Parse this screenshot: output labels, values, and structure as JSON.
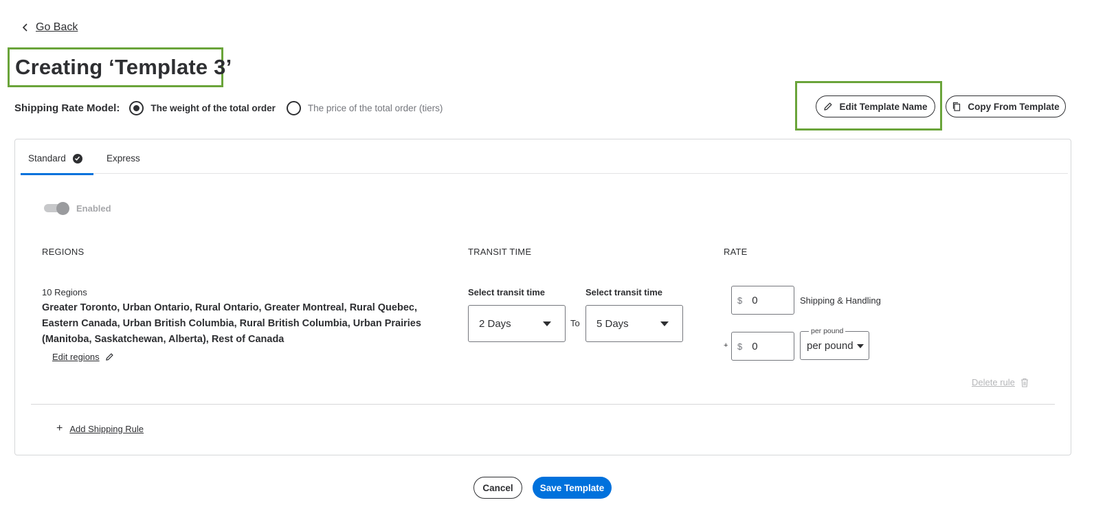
{
  "nav": {
    "go_back_label": "Go Back"
  },
  "header": {
    "title": "Creating ‘Template 3’",
    "shipping_rate_model_label": "Shipping Rate Model:",
    "rate_model_options": [
      {
        "label": "The weight of the total order",
        "selected": true
      },
      {
        "label": "The price of the total order (tiers)",
        "selected": false
      }
    ],
    "edit_template_name_label": "Edit Template Name",
    "copy_from_template_label": "Copy From Template"
  },
  "tabs": [
    {
      "label": "Standard",
      "active": true,
      "completed": true
    },
    {
      "label": "Express",
      "active": false
    }
  ],
  "toggle": {
    "label": "Enabled",
    "on": true,
    "disabled": true
  },
  "columns": {
    "regions": "REGIONS",
    "transit_time": "TRANSIT TIME",
    "rate": "RATE"
  },
  "rule": {
    "regions_count": "10 Regions",
    "regions_list": "Greater Toronto, Urban Ontario, Rural Ontario, Greater Montreal, Rural Quebec, Eastern Canada, Urban British Columbia, Rural British Columbia, Urban Prairies (Manitoba, Saskatchewan, Alberta), Rest of Canada",
    "edit_regions_label": "Edit regions",
    "transit_from_label": "Select transit time",
    "transit_from_value": "2 Days",
    "transit_to_label": "Select transit time",
    "transit_to_value": "5 Days",
    "to_label": "To",
    "currency_symbol": "$",
    "shipping_handling_value": "0",
    "shipping_handling_label": "Shipping & Handling",
    "plus_symbol": "+",
    "per_unit_value": "0",
    "unit_legend": "per pound",
    "unit_value": "per pound",
    "delete_rule_label": "Delete rule"
  },
  "add_rule_label": "Add Shipping Rule",
  "footer": {
    "cancel_label": "Cancel",
    "save_label": "Save Template"
  },
  "colors": {
    "accent": "#0071dc",
    "highlight": "#6aa43a",
    "text": "#2e2f32"
  }
}
